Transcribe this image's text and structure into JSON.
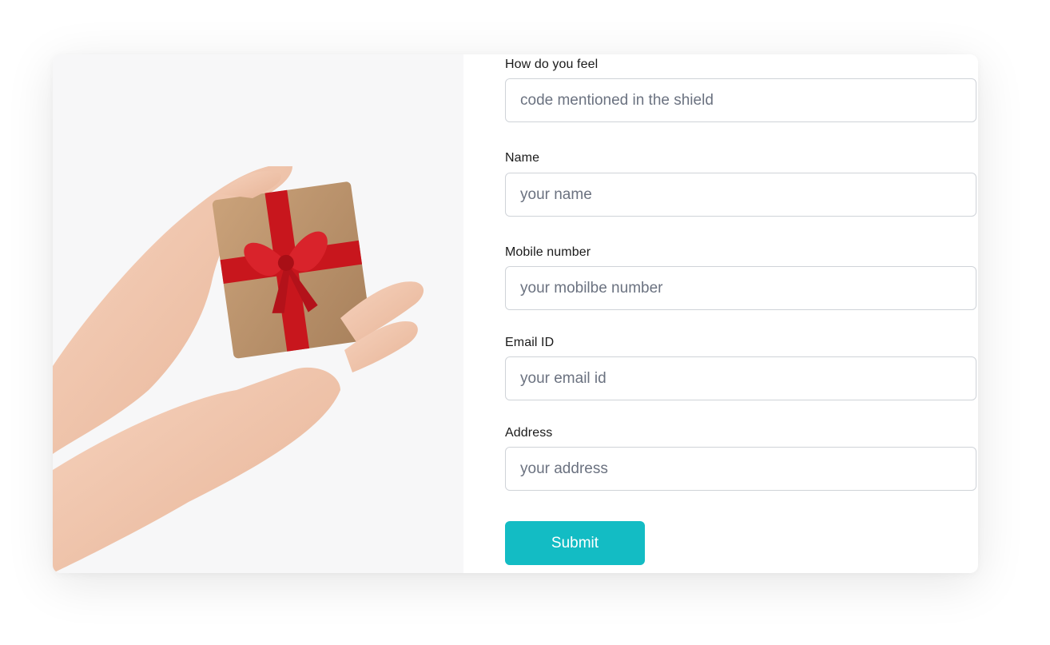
{
  "image": {
    "description_icon": "gift-box-image"
  },
  "form": {
    "fields": [
      {
        "label": "How do you feel",
        "placeholder": "code mentioned in the shield",
        "value": ""
      },
      {
        "label": "Name",
        "placeholder": "your name",
        "value": ""
      },
      {
        "label": "Mobile number",
        "placeholder": "your mobilbe number",
        "value": ""
      },
      {
        "label": "Email ID",
        "placeholder": "your email id",
        "value": ""
      },
      {
        "label": "Address",
        "placeholder": "your address",
        "value": ""
      }
    ],
    "submit_label": "Submit"
  },
  "colors": {
    "accent": "#13bcc4",
    "input_border": "#cfd3d8",
    "placeholder": "#6b7280",
    "label": "#1a1a1a"
  }
}
